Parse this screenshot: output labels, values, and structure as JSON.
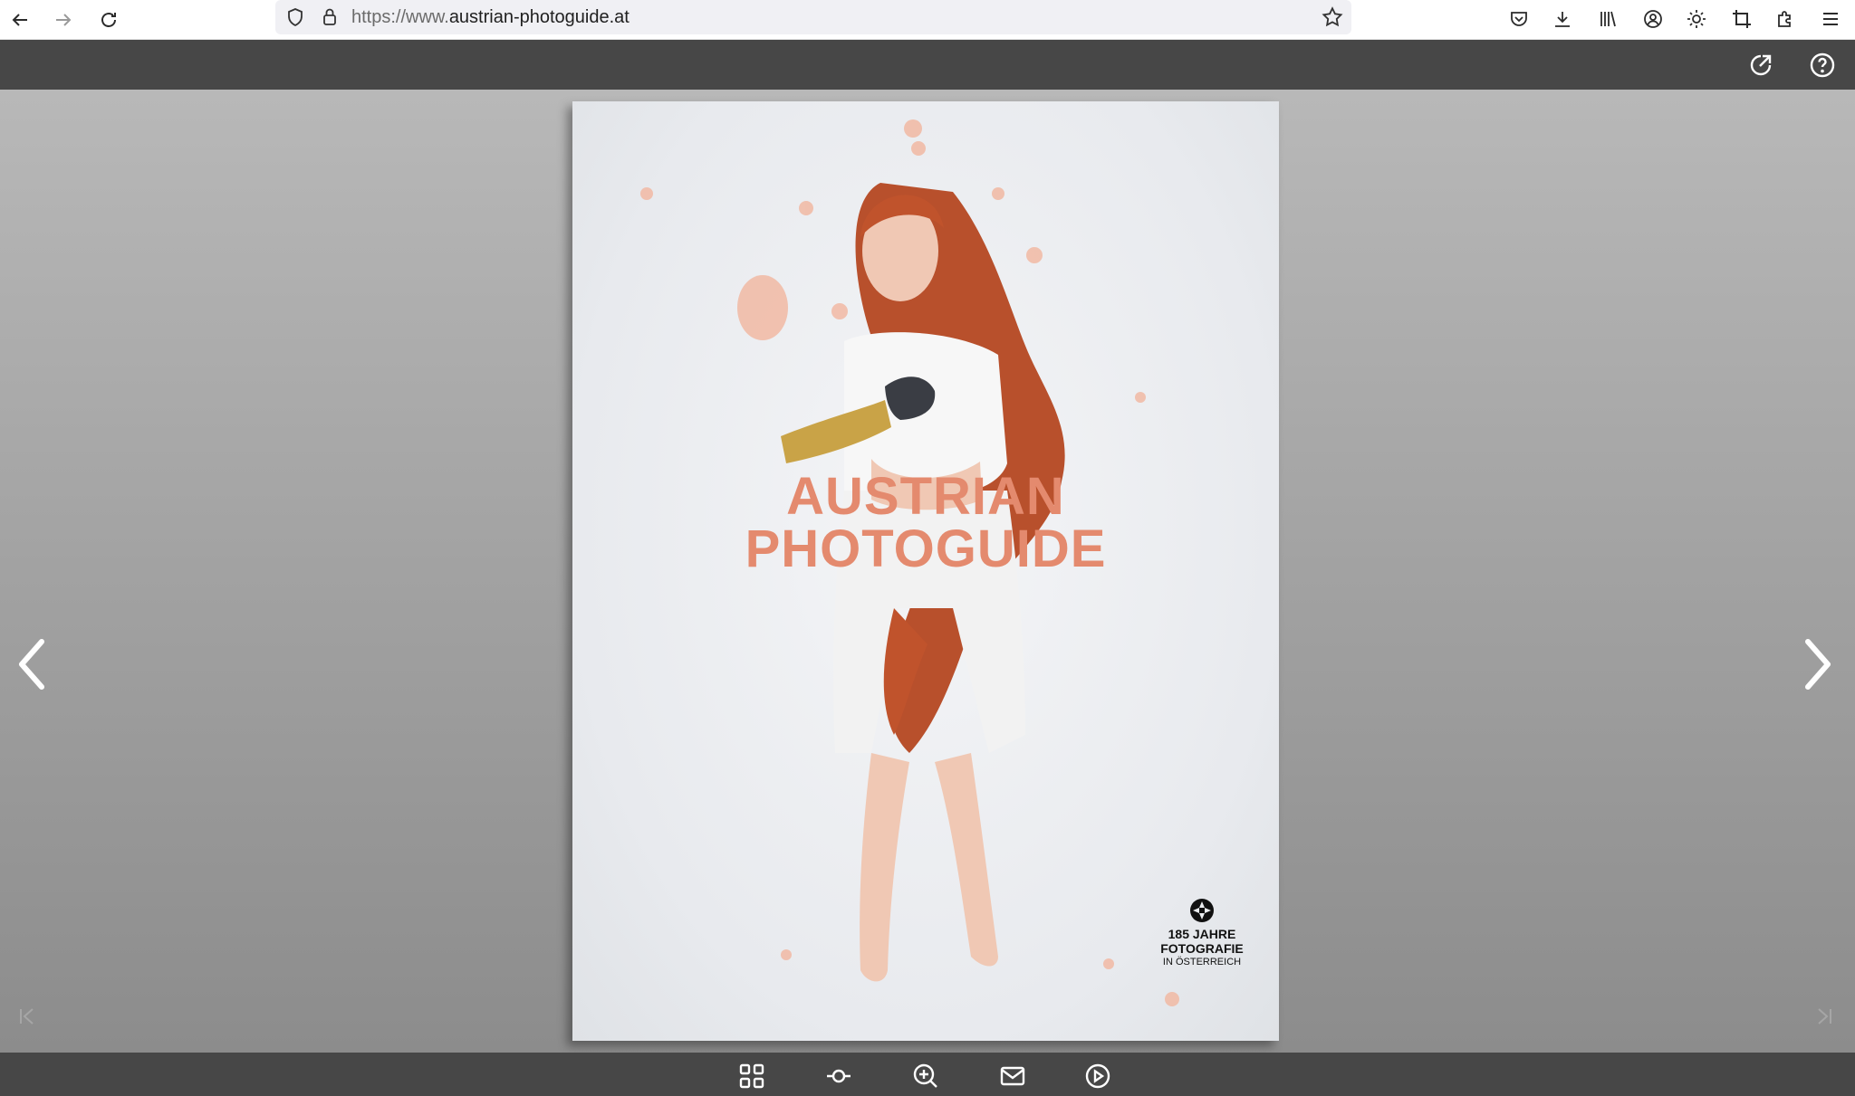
{
  "browser": {
    "url_prefix": "https://www.",
    "url_domain": "austrian-photoguide.at"
  },
  "cover": {
    "title_line1": "AUSTRIAN",
    "title_line2": "PHOTOGUIDE",
    "badge_line1": "185 JAHRE",
    "badge_line2": "FOTOGRAFIE",
    "badge_line3": "IN ÖSTERREICH",
    "title_color": "#e48a6e"
  },
  "colors": {
    "toolbar_bg": "#474747",
    "stage_top": "#b8b8b8",
    "stage_bottom": "#8c8c8c"
  }
}
